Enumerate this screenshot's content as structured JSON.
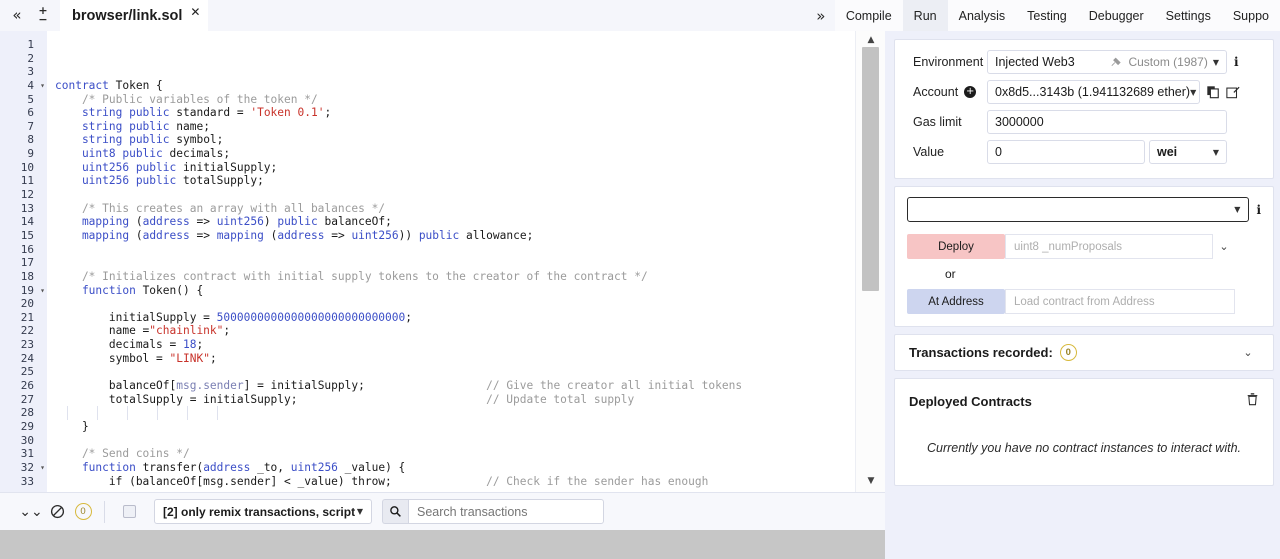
{
  "topbar": {
    "collapse_left_icon": "chevrons-left-icon",
    "collapse_left_glyph": "«",
    "font_increase": "+",
    "font_decrease": "−",
    "file_tab_name": "browser/link.sol",
    "file_tab_close": "✕",
    "collapse_right_glyph": "»",
    "nav_tabs": [
      {
        "label": "Compile",
        "active": false
      },
      {
        "label": "Run",
        "active": true
      },
      {
        "label": "Analysis",
        "active": false
      },
      {
        "label": "Testing",
        "active": false
      },
      {
        "label": "Debugger",
        "active": false
      },
      {
        "label": "Settings",
        "active": false
      },
      {
        "label": "Suppo",
        "active": false
      }
    ]
  },
  "editor": {
    "first_line": 1,
    "fold_lines": [
      4,
      19,
      32
    ],
    "lines": [
      {
        "n": 1,
        "segs": []
      },
      {
        "n": 2,
        "segs": []
      },
      {
        "n": 3,
        "segs": []
      },
      {
        "n": 4,
        "segs": [
          {
            "t": "contract ",
            "c": "k"
          },
          {
            "t": "Token {",
            "c": "fn"
          }
        ]
      },
      {
        "n": 5,
        "segs": [
          {
            "t": "    /* Public variables of the token */",
            "c": "cm"
          }
        ]
      },
      {
        "n": 6,
        "segs": [
          {
            "t": "    string public ",
            "c": "k"
          },
          {
            "t": "standard = ",
            "c": "fn"
          },
          {
            "t": "'Token 0.1'",
            "c": "st"
          },
          {
            "t": ";",
            "c": "fn"
          }
        ]
      },
      {
        "n": 7,
        "segs": [
          {
            "t": "    string public ",
            "c": "k"
          },
          {
            "t": "name;",
            "c": "fn"
          }
        ]
      },
      {
        "n": 8,
        "segs": [
          {
            "t": "    string public ",
            "c": "k"
          },
          {
            "t": "symbol;",
            "c": "fn"
          }
        ]
      },
      {
        "n": 9,
        "segs": [
          {
            "t": "    uint8 public ",
            "c": "k"
          },
          {
            "t": "decimals;",
            "c": "fn"
          }
        ]
      },
      {
        "n": 10,
        "segs": [
          {
            "t": "    uint256 public ",
            "c": "k"
          },
          {
            "t": "initialSupply;",
            "c": "fn"
          }
        ]
      },
      {
        "n": 11,
        "segs": [
          {
            "t": "    uint256 public ",
            "c": "k"
          },
          {
            "t": "totalSupply;",
            "c": "fn"
          }
        ]
      },
      {
        "n": 12,
        "segs": []
      },
      {
        "n": 13,
        "segs": [
          {
            "t": "    /* This creates an array with all balances */",
            "c": "cm"
          }
        ]
      },
      {
        "n": 14,
        "segs": [
          {
            "t": "    mapping ",
            "c": "k"
          },
          {
            "t": "(",
            "c": "fn"
          },
          {
            "t": "address ",
            "c": "k"
          },
          {
            "t": "=> ",
            "c": "fn"
          },
          {
            "t": "uint256",
            "c": "k"
          },
          {
            "t": ") ",
            "c": "fn"
          },
          {
            "t": "public ",
            "c": "k"
          },
          {
            "t": "balanceOf;",
            "c": "fn"
          }
        ]
      },
      {
        "n": 15,
        "segs": [
          {
            "t": "    mapping ",
            "c": "k"
          },
          {
            "t": "(",
            "c": "fn"
          },
          {
            "t": "address ",
            "c": "k"
          },
          {
            "t": "=> ",
            "c": "fn"
          },
          {
            "t": "mapping ",
            "c": "k"
          },
          {
            "t": "(",
            "c": "fn"
          },
          {
            "t": "address ",
            "c": "k"
          },
          {
            "t": "=> ",
            "c": "fn"
          },
          {
            "t": "uint256",
            "c": "k"
          },
          {
            "t": ")) ",
            "c": "fn"
          },
          {
            "t": "public ",
            "c": "k"
          },
          {
            "t": "allowance;",
            "c": "fn"
          }
        ]
      },
      {
        "n": 16,
        "segs": []
      },
      {
        "n": 17,
        "segs": []
      },
      {
        "n": 18,
        "segs": [
          {
            "t": "    /* Initializes contract with initial supply tokens to the creator of the contract */",
            "c": "cm"
          }
        ]
      },
      {
        "n": 19,
        "segs": [
          {
            "t": "    function ",
            "c": "k"
          },
          {
            "t": "Token() {",
            "c": "fn"
          }
        ]
      },
      {
        "n": 20,
        "segs": []
      },
      {
        "n": 21,
        "segs": [
          {
            "t": "        initialSupply = ",
            "c": "fn"
          },
          {
            "t": "5000000000000000000000000000",
            "c": "nm"
          },
          {
            "t": ";",
            "c": "fn"
          }
        ]
      },
      {
        "n": 22,
        "segs": [
          {
            "t": "        name =",
            "c": "fn"
          },
          {
            "t": "\"chainlink\"",
            "c": "st"
          },
          {
            "t": ";",
            "c": "fn"
          }
        ]
      },
      {
        "n": 23,
        "segs": [
          {
            "t": "        decimals = ",
            "c": "fn"
          },
          {
            "t": "18",
            "c": "nm"
          },
          {
            "t": ";",
            "c": "fn"
          }
        ]
      },
      {
        "n": 24,
        "segs": [
          {
            "t": "        symbol = ",
            "c": "fn"
          },
          {
            "t": "\"LINK\"",
            "c": "st"
          },
          {
            "t": ";",
            "c": "fn"
          }
        ]
      },
      {
        "n": 25,
        "segs": []
      },
      {
        "n": 26,
        "segs": [
          {
            "t": "        balanceOf[",
            "c": "fn"
          },
          {
            "t": "msg.sender",
            "c": "ms"
          },
          {
            "t": "] = initialSupply;",
            "c": "fn"
          }
        ],
        "comment": "// Give the creator all initial tokens"
      },
      {
        "n": 27,
        "segs": [
          {
            "t": "        totalSupply = initialSupply;",
            "c": "fn"
          }
        ],
        "comment": "// Update total supply"
      },
      {
        "n": 28,
        "segs": []
      },
      {
        "n": 29,
        "segs": [
          {
            "t": "    }",
            "c": "fn"
          }
        ]
      },
      {
        "n": 30,
        "segs": []
      },
      {
        "n": 31,
        "segs": [
          {
            "t": "    /* Send coins */",
            "c": "cm"
          }
        ]
      },
      {
        "n": 32,
        "segs": [
          {
            "t": "    function ",
            "c": "k"
          },
          {
            "t": "transfer(",
            "c": "fn"
          },
          {
            "t": "address ",
            "c": "k"
          },
          {
            "t": "_to, ",
            "c": "fn"
          },
          {
            "t": "uint256 ",
            "c": "k"
          },
          {
            "t": "_value) {",
            "c": "fn"
          }
        ]
      },
      {
        "n": 33,
        "segs": [
          {
            "t": "        if (balanceOf[msg.sender] < _value) throw;",
            "c": "fn"
          }
        ],
        "comment": "// Check if the sender has enough"
      }
    ]
  },
  "terminal_bar": {
    "collapse_icon": "chevrons-down-icon",
    "collapse_glyph": "⌄",
    "ban_icon": "ban-icon",
    "error_count": "0",
    "checkbox_checked": false,
    "filter_select_value": "[2] only remix transactions, script",
    "search_icon": "search-icon",
    "search_placeholder": "Search transactions",
    "search_value": ""
  },
  "run_panel": {
    "environment": {
      "label": "Environment",
      "value": "Injected Web3",
      "network_icon": "plug-icon",
      "network": "Custom (1987)",
      "info_icon": "info-icon"
    },
    "account": {
      "label": "Account",
      "add_icon": "plus-circle-icon",
      "value": "0x8d5...3143b (1.941132689 ether)",
      "copy_icon": "copy-icon",
      "edit_icon": "edit-icon"
    },
    "gas_limit": {
      "label": "Gas limit",
      "value": "3000000"
    },
    "value": {
      "label": "Value",
      "value": "0",
      "unit": "wei"
    },
    "contract_select": {
      "value": "",
      "info_icon": "info-icon"
    },
    "deploy": {
      "button_label": "Deploy",
      "arg_placeholder": "uint8 _numProposals",
      "expand_icon": "chevron-down-icon",
      "or_label": "or",
      "at_address_label": "At Address",
      "at_address_placeholder": "Load contract from Address"
    },
    "transactions": {
      "title": "Transactions recorded:",
      "count": "0",
      "toggle_icon": "chevron-down-icon"
    },
    "deployed_contracts": {
      "title": "Deployed Contracts",
      "trash_icon": "trash-icon",
      "empty_message": "Currently you have no contract instances to interact with."
    }
  },
  "colors": {
    "panel_bg": "#eef0fa",
    "deploy_btn": "#f7c5c5",
    "at_address_btn": "#cdd5ef",
    "badge_yellow": "#d7b93c",
    "keyword_blue": "#3b4ec7",
    "string_red": "#c8322a",
    "comment_gray": "#9b9b9b"
  }
}
